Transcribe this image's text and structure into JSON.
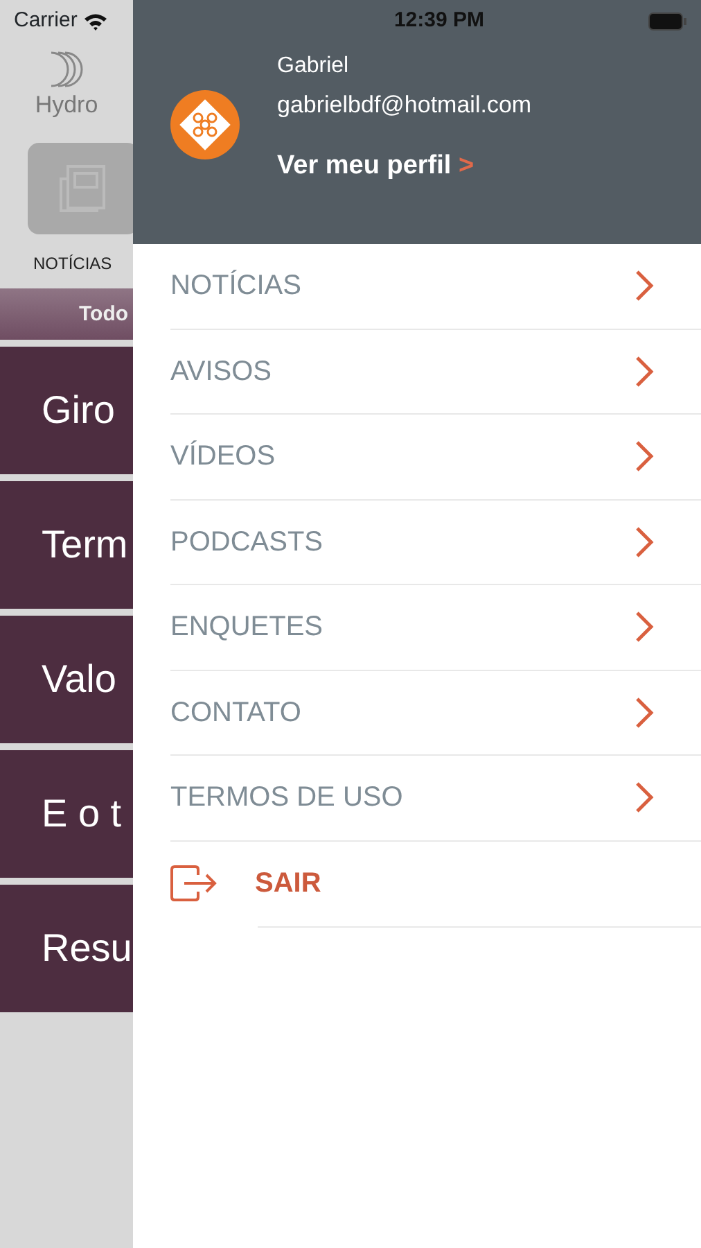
{
  "status_bar": {
    "carrier": "Carrier",
    "time": "12:39 PM"
  },
  "background_app": {
    "logo_text": "Hydro",
    "tab_label": "NOTÍCIAS",
    "filter_label": "Todo",
    "cards": [
      "Giro",
      "Term",
      "Valo",
      "E o t",
      "Resu"
    ]
  },
  "drawer": {
    "user": {
      "name": "Gabriel",
      "email": "gabrielbdf@hotmail.com",
      "profile_link": "Ver meu perfil",
      "profile_arrow": ">"
    },
    "menu": [
      {
        "label": "NOTÍCIAS",
        "kind": "nav"
      },
      {
        "label": "AVISOS",
        "kind": "nav"
      },
      {
        "label": "VÍDEOS",
        "kind": "nav"
      },
      {
        "label": "PODCASTS",
        "kind": "nav"
      },
      {
        "label": "ENQUETES",
        "kind": "nav"
      },
      {
        "label": "CONTATO",
        "kind": "nav"
      },
      {
        "label": "TERMOS DE USO",
        "kind": "nav"
      },
      {
        "label": "SAIR",
        "kind": "logout"
      }
    ]
  }
}
